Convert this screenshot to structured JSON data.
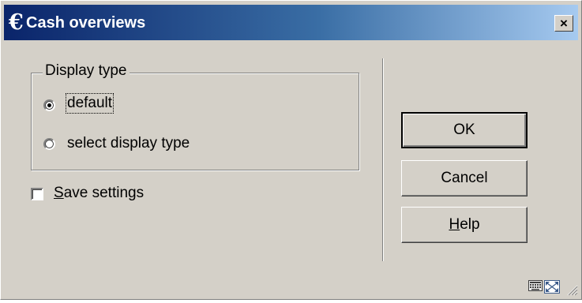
{
  "window": {
    "title": "Cash overviews",
    "title_icon": "€",
    "close_label": "×"
  },
  "display_type": {
    "legend": "Display type",
    "options": [
      {
        "label": "default",
        "selected": true
      },
      {
        "label": "select display type",
        "selected": false
      }
    ]
  },
  "save_settings": {
    "label_rest": "ave settings",
    "label_mnemonic": "S",
    "checked": false
  },
  "buttons": {
    "ok": "OK",
    "cancel": "Cancel",
    "help_mnemonic": "H",
    "help_rest": "elp"
  },
  "status_icons": [
    "keyboard-icon",
    "resize-icon",
    "size-grip-icon"
  ],
  "colors": {
    "dialog_bg": "#d4d0c8",
    "title_gradient_start": "#0a246a",
    "title_gradient_end": "#a6caf0"
  }
}
